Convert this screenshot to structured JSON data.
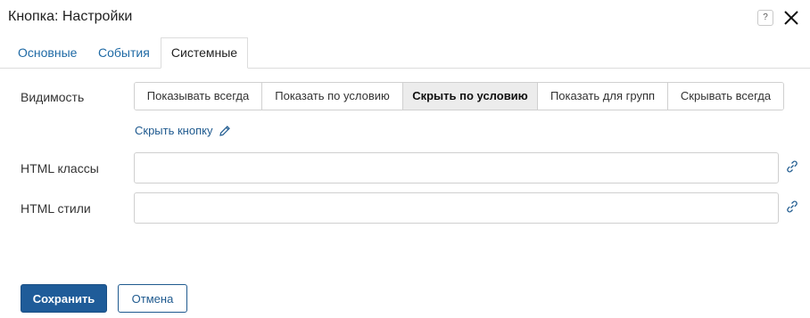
{
  "dialog": {
    "title": "Кнопка: Настройки",
    "help_label": "?"
  },
  "tabs": [
    {
      "label": "Основные",
      "active": false
    },
    {
      "label": "События",
      "active": false
    },
    {
      "label": "Системные",
      "active": true
    }
  ],
  "visibility": {
    "label": "Видимость",
    "options": [
      {
        "label": "Показывать всегда",
        "active": false
      },
      {
        "label": "Показать по условию",
        "active": false
      },
      {
        "label": "Скрыть по условию",
        "active": true
      },
      {
        "label": "Показать для групп",
        "active": false
      },
      {
        "label": "Скрывать всегда",
        "active": false
      }
    ],
    "condition_link": "Скрыть кнопку"
  },
  "fields": {
    "html_classes": {
      "label": "HTML классы",
      "value": ""
    },
    "html_styles": {
      "label": "HTML стили",
      "value": ""
    }
  },
  "footer": {
    "save_label": "Сохранить",
    "cancel_label": "Отмена"
  },
  "colors": {
    "accent": "#1f5c99",
    "link": "#1f5a8f",
    "active_segment": "#ececec"
  }
}
